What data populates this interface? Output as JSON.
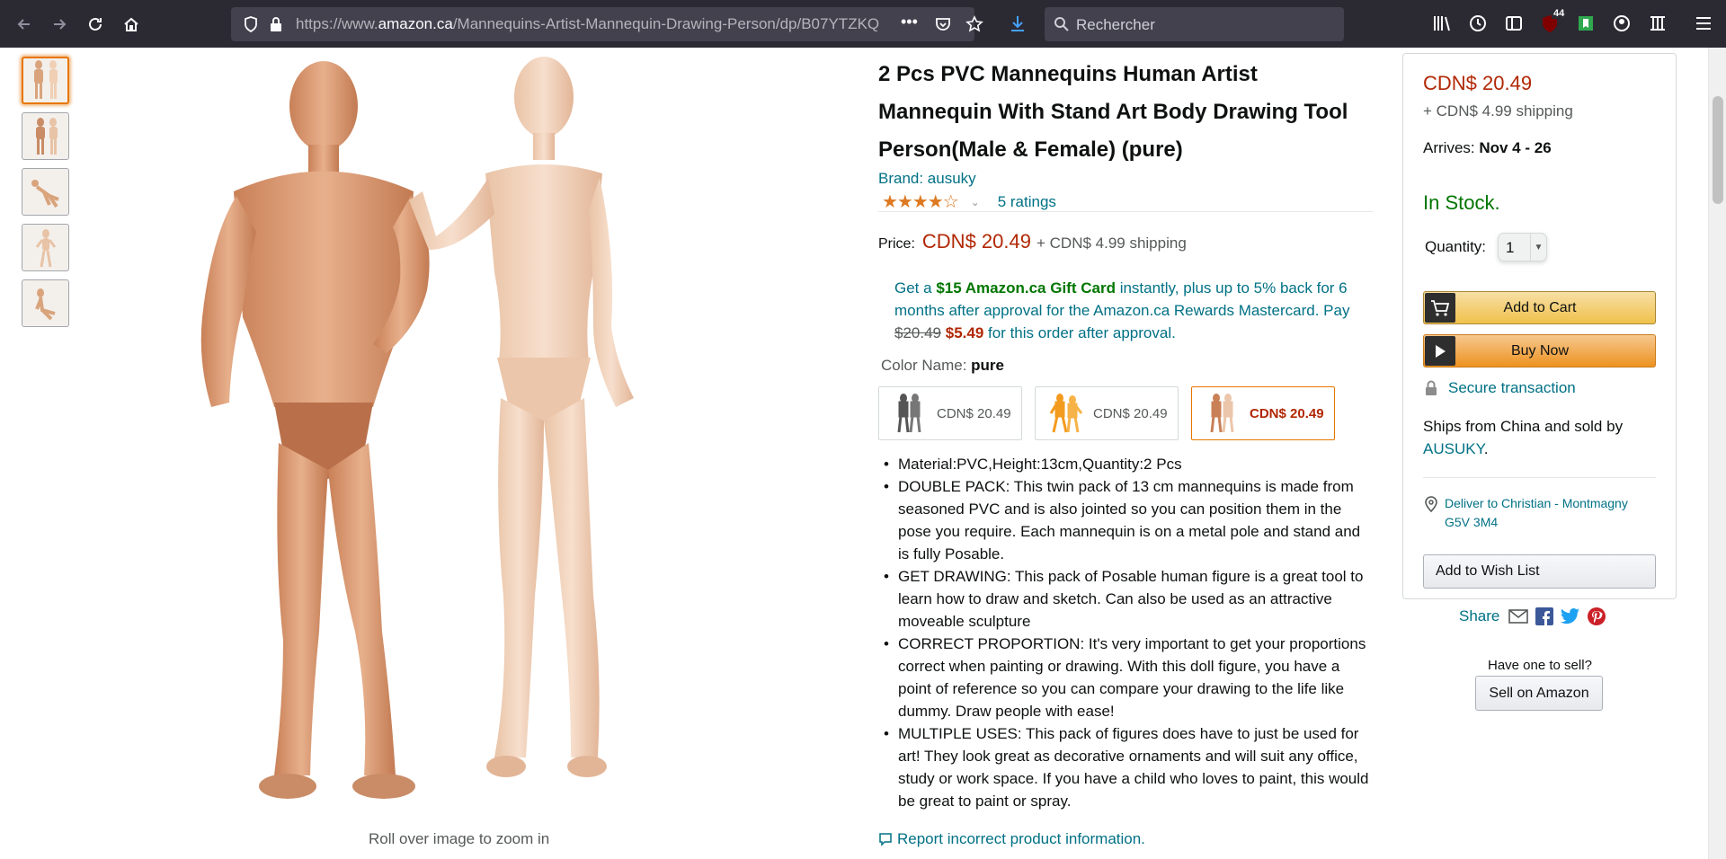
{
  "browser": {
    "url_prefix": "https://www.",
    "url_domain": "amazon.ca",
    "url_path": "/Mannequins-Artist-Mannequin-Drawing-Person/dp/B07YTZKQ",
    "search_placeholder": "Rechercher",
    "extension_badge": "44"
  },
  "gallery": {
    "thumbnails": [
      "thumb-1",
      "thumb-2",
      "thumb-3",
      "thumb-4",
      "thumb-5"
    ],
    "zoom_hint": "Roll over image to zoom in"
  },
  "product": {
    "title": "2 Pcs PVC Mannequins Human Artist Mannequin With Stand Art Body Drawing Tool Person(Male & Female) (pure)",
    "brand": "Brand: ausuky",
    "stars": "★★★★☆",
    "rating_fraction": 0.8,
    "ratings_count": "5 ratings",
    "price_label": "Price:",
    "price": "CDN$ 20.49",
    "shipping": "+ CDN$ 4.99 shipping",
    "promo": {
      "p1": "Get a ",
      "gift": "$15 Amazon.ca Gift Card",
      "p2": " instantly, plus up to 5% back for 6 months after approval for the Amazon.ca Rewards Mastercard. Pay ",
      "old_price": "$20.49",
      "new_price": "$5.49",
      "p3": " for this order after approval."
    },
    "color_label": "Color Name: ",
    "color_value": "pure",
    "swatches": [
      {
        "price": "CDN$ 20.49"
      },
      {
        "price": "CDN$ 20.49"
      },
      {
        "price": "CDN$ 20.49"
      }
    ],
    "bullets": [
      "Material:PVC,Height:13cm,Quantity:2 Pcs",
      "DOUBLE PACK: This twin pack of 13 cm mannequins is made from seasoned PVC and is also jointed so you can position them in the pose you require. Each mannequin is on a metal pole and stand and is fully Posable.",
      "GET DRAWING: This pack of Posable human figure is a great tool to learn how to draw and sketch. Can also be used as an attractive moveable sculpture",
      "CORRECT PROPORTION: It's very important to get your proportions correct when painting or drawing. With this doll figure, you have a point of reference so you can compare your drawing to the life like dummy. Draw people with ease!",
      "MULTIPLE USES: This pack of figures does have to just be used for art! They look great as decorative ornaments and will suit any office, study or work space. If you have a child who loves to paint, this would be great to paint or spray."
    ],
    "report_link": "Report incorrect product information."
  },
  "buybox": {
    "price": "CDN$ 20.49",
    "shipping": "+ CDN$ 4.99 shipping",
    "arrives_label": "Arrives: ",
    "arrives_date": "Nov 4 - 26",
    "stock": "In Stock.",
    "quantity_label": "Quantity:",
    "quantity_value": "1",
    "add_to_cart": "Add to Cart",
    "buy_now": "Buy Now",
    "secure": "Secure transaction",
    "ships_from": "Ships from China and sold by ",
    "seller": "AUSUKY",
    "seller_suffix": ".",
    "deliver_line1": "Deliver to Christian - Montmagny",
    "deliver_line2": "G5V 3M4",
    "wishlist": "Add to Wish List"
  },
  "share": {
    "label": "Share",
    "sell_question": "Have one to sell?",
    "sell_button": "Sell on Amazon"
  },
  "colors": {
    "link": "#007185",
    "price": "#b12704",
    "stock": "#007600",
    "star": "#de7921"
  }
}
